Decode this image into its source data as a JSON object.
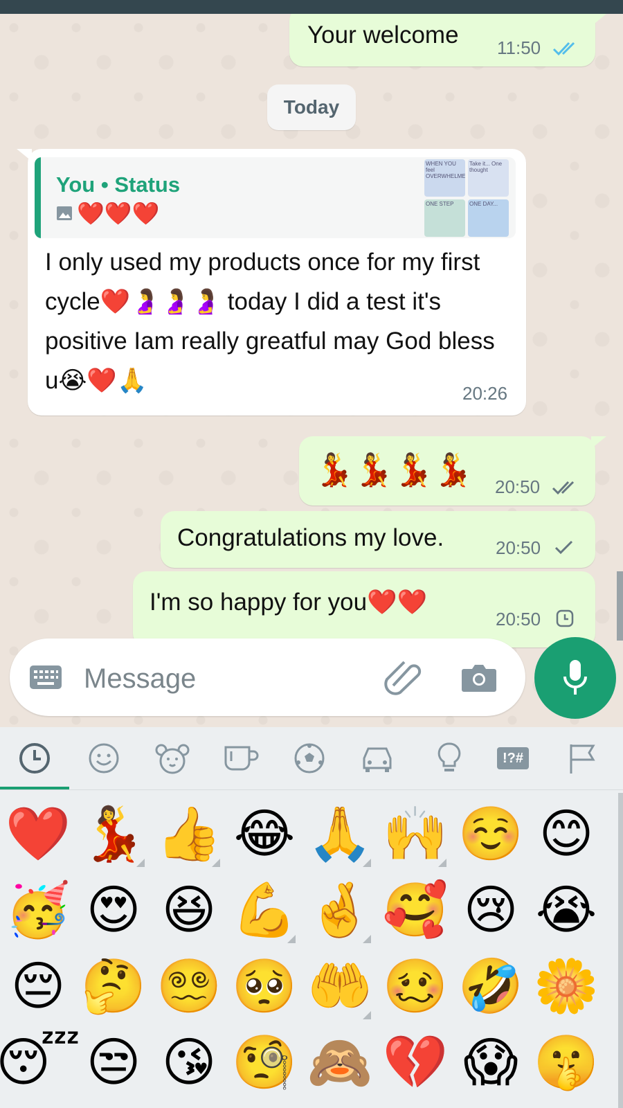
{
  "colors": {
    "outgoing_bubble": "#e7fcd8",
    "incoming_bubble": "#ffffff",
    "accent_green": "#1a9f72",
    "read_tick_blue": "#53bdeb",
    "status_bar": "#34474f"
  },
  "messages": [
    {
      "text": "Your welcome",
      "time": "11:50",
      "status": "read"
    },
    {
      "text": "I only used my products once for my first cycle❤️🤰🤰🤰 today I did a test it's positive Iam really greatful may God bless u😭❤️🙏",
      "time": "20:26",
      "quote": {
        "author": "You",
        "separator": "•",
        "source": "Status",
        "content": "❤️❤️❤️"
      }
    },
    {
      "text": "💃💃💃💃",
      "time": "20:50",
      "status": "delivered"
    },
    {
      "text": "Congratulations my love.",
      "time": "20:50",
      "status": "sent"
    },
    {
      "text": "I'm so happy for you❤️❤️",
      "time": "20:50",
      "status": "pending"
    }
  ],
  "date_divider": "Today",
  "thumb_texts": [
    "WHEN YOU feel OVERWHELMED",
    "Take it... One thought",
    "ONE STEP",
    "ONE DAY..."
  ],
  "composer": {
    "placeholder": "Message"
  },
  "emoji_categories": [
    "recent-icon",
    "smileys-icon",
    "animals-icon",
    "food-icon",
    "activity-icon",
    "travel-icon",
    "objects-icon",
    "symbols-icon",
    "flags-icon"
  ],
  "symbols_label": "!?#",
  "emoji_grid": [
    [
      "❤️",
      "💃",
      "👍",
      "😂",
      "🙏",
      "🙌",
      "☺️",
      "😊"
    ],
    [
      "🥳",
      "😍",
      "😆",
      "💪",
      "🤞",
      "🥰",
      "😢",
      "😭"
    ],
    [
      "😔",
      "🤔",
      "😵‍💫",
      "🥺",
      "🤲",
      "🥴",
      "🤣",
      "🌼"
    ],
    [
      "😴",
      "😒",
      "😘",
      "🧐",
      "🙈",
      "💔",
      "😱",
      "🤫"
    ]
  ]
}
